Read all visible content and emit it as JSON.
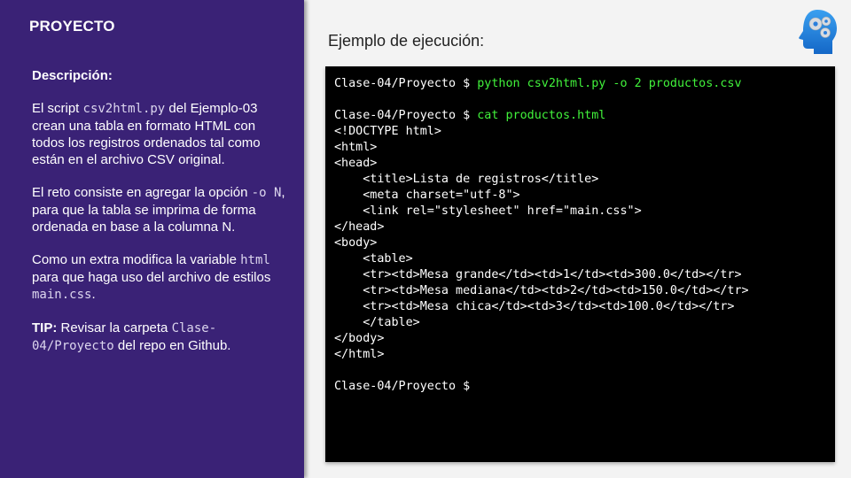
{
  "sidebar": {
    "title": "PROYECTO",
    "desc_heading": "Descripción:",
    "p1": {
      "t1": "El script ",
      "code1": "csv2html.py",
      "t2": " del Ejemplo-03 crean una tabla en formato HTML con todos los registros ordenados tal como están en el archivo CSV original."
    },
    "p2": {
      "t1": "El reto consiste en agregar la opción ",
      "code1": "-o N",
      "t2": ", para que la tabla se imprima de forma ordenada en base a la columna N."
    },
    "p3": {
      "t1": "Como un extra modifica la variable ",
      "code1": "html",
      "t2": " para que haga uso del archivo de estilos ",
      "code2": "main.css",
      "t3": "."
    },
    "p4": {
      "tip": "TIP:",
      "t1": " Revisar la carpeta ",
      "code1": "Clase-04/Proyecto",
      "t2": " del repo en Github."
    }
  },
  "main": {
    "title": "Ejemplo de ejecución:"
  },
  "terminal": {
    "lines": [
      {
        "prompt": "Clase-04/Proyecto $ ",
        "cmd": "python csv2html.py -o 2 productos.csv",
        "text": ""
      },
      {
        "prompt": "",
        "cmd": "",
        "text": ""
      },
      {
        "prompt": "Clase-04/Proyecto $ ",
        "cmd": "cat productos.html",
        "text": ""
      },
      {
        "prompt": "",
        "cmd": "",
        "text": "<!DOCTYPE html>"
      },
      {
        "prompt": "",
        "cmd": "",
        "text": "<html>"
      },
      {
        "prompt": "",
        "cmd": "",
        "text": "<head>"
      },
      {
        "prompt": "",
        "cmd": "",
        "text": "    <title>Lista de registros</title>"
      },
      {
        "prompt": "",
        "cmd": "",
        "text": "    <meta charset=\"utf-8\">"
      },
      {
        "prompt": "",
        "cmd": "",
        "text": "    <link rel=\"stylesheet\" href=\"main.css\">"
      },
      {
        "prompt": "",
        "cmd": "",
        "text": "</head>"
      },
      {
        "prompt": "",
        "cmd": "",
        "text": "<body>"
      },
      {
        "prompt": "",
        "cmd": "",
        "text": "    <table>"
      },
      {
        "prompt": "",
        "cmd": "",
        "text": "    <tr><td>Mesa grande</td><td>1</td><td>300.0</td></tr>"
      },
      {
        "prompt": "",
        "cmd": "",
        "text": "    <tr><td>Mesa mediana</td><td>2</td><td>150.0</td></tr>"
      },
      {
        "prompt": "",
        "cmd": "",
        "text": "    <tr><td>Mesa chica</td><td>3</td><td>100.0</td></tr>"
      },
      {
        "prompt": "",
        "cmd": "",
        "text": "    </table>"
      },
      {
        "prompt": "",
        "cmd": "",
        "text": "</body>"
      },
      {
        "prompt": "",
        "cmd": "",
        "text": "</html>"
      },
      {
        "prompt": "",
        "cmd": "",
        "text": ""
      },
      {
        "prompt": "Clase-04/Proyecto $ ",
        "cmd": "",
        "text": ""
      }
    ]
  },
  "colors": {
    "sidebar_bg": "#3a2276",
    "command_green": "#41f23b",
    "terminal_bg": "#000000"
  },
  "icons": {
    "logo": "head-with-gears-icon"
  }
}
